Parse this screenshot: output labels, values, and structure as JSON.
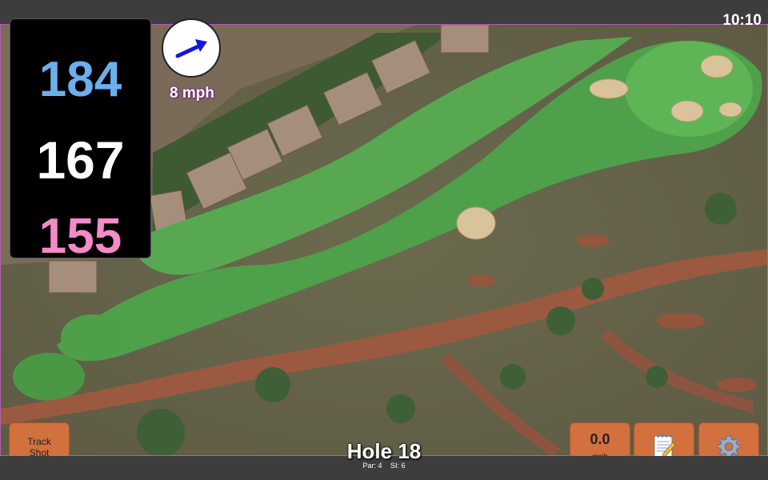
{
  "status_bar": {
    "time": "10:10"
  },
  "distances": {
    "back": "184",
    "middle": "167",
    "front": "155"
  },
  "wind": {
    "speed_label": "8 mph",
    "direction_icon": "arrow-icon"
  },
  "buttons": {
    "track_shot_line1": "Track",
    "track_shot_line2": "Shot",
    "speed_value": "0.0",
    "speed_unit": "mph",
    "notes_icon": "notepad-icon",
    "settings_icon": "gear-icon"
  },
  "hole": {
    "title": "Hole 18",
    "par": "Par: 4",
    "si": "SI: 6"
  },
  "colors": {
    "back_distance": "#6ab0ee",
    "middle_distance": "#ffffff",
    "front_distance": "#f48ac8",
    "button": "#d2703e",
    "fairway": "#4ea04a"
  }
}
